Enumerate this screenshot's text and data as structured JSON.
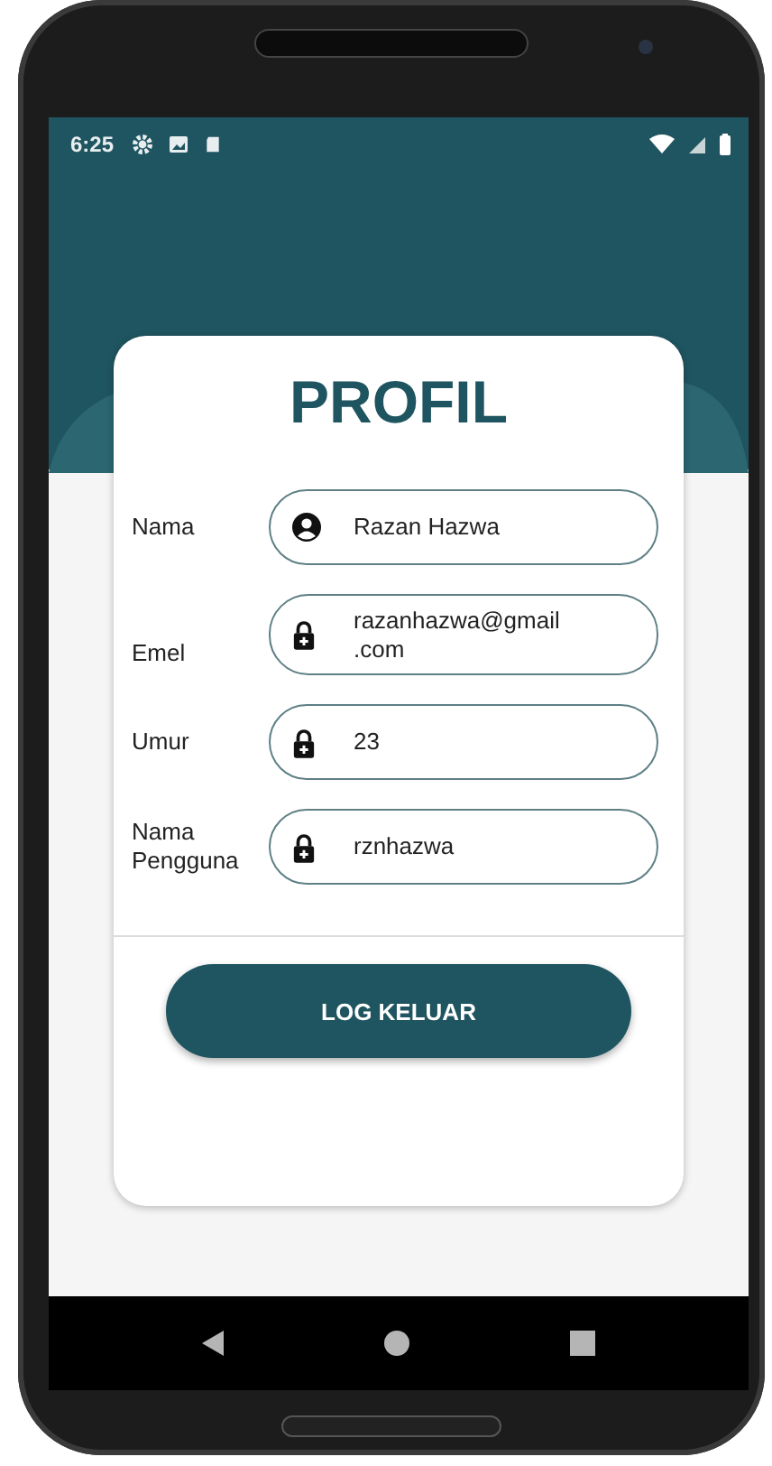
{
  "status_bar": {
    "time": "6:25"
  },
  "title": "PROFIL",
  "fields": [
    {
      "label": "Nama",
      "value": "Razan Hazwa",
      "kind": "person"
    },
    {
      "label": "Emel",
      "value": "razanhazwa@gmail\n.com",
      "kind": "lock"
    },
    {
      "label": "Umur",
      "value": "23",
      "kind": "lock"
    },
    {
      "label": "Nama\nPengguna",
      "value": "rznhazwa",
      "kind": "lock"
    }
  ],
  "logout_button": "LOG KELUAR"
}
